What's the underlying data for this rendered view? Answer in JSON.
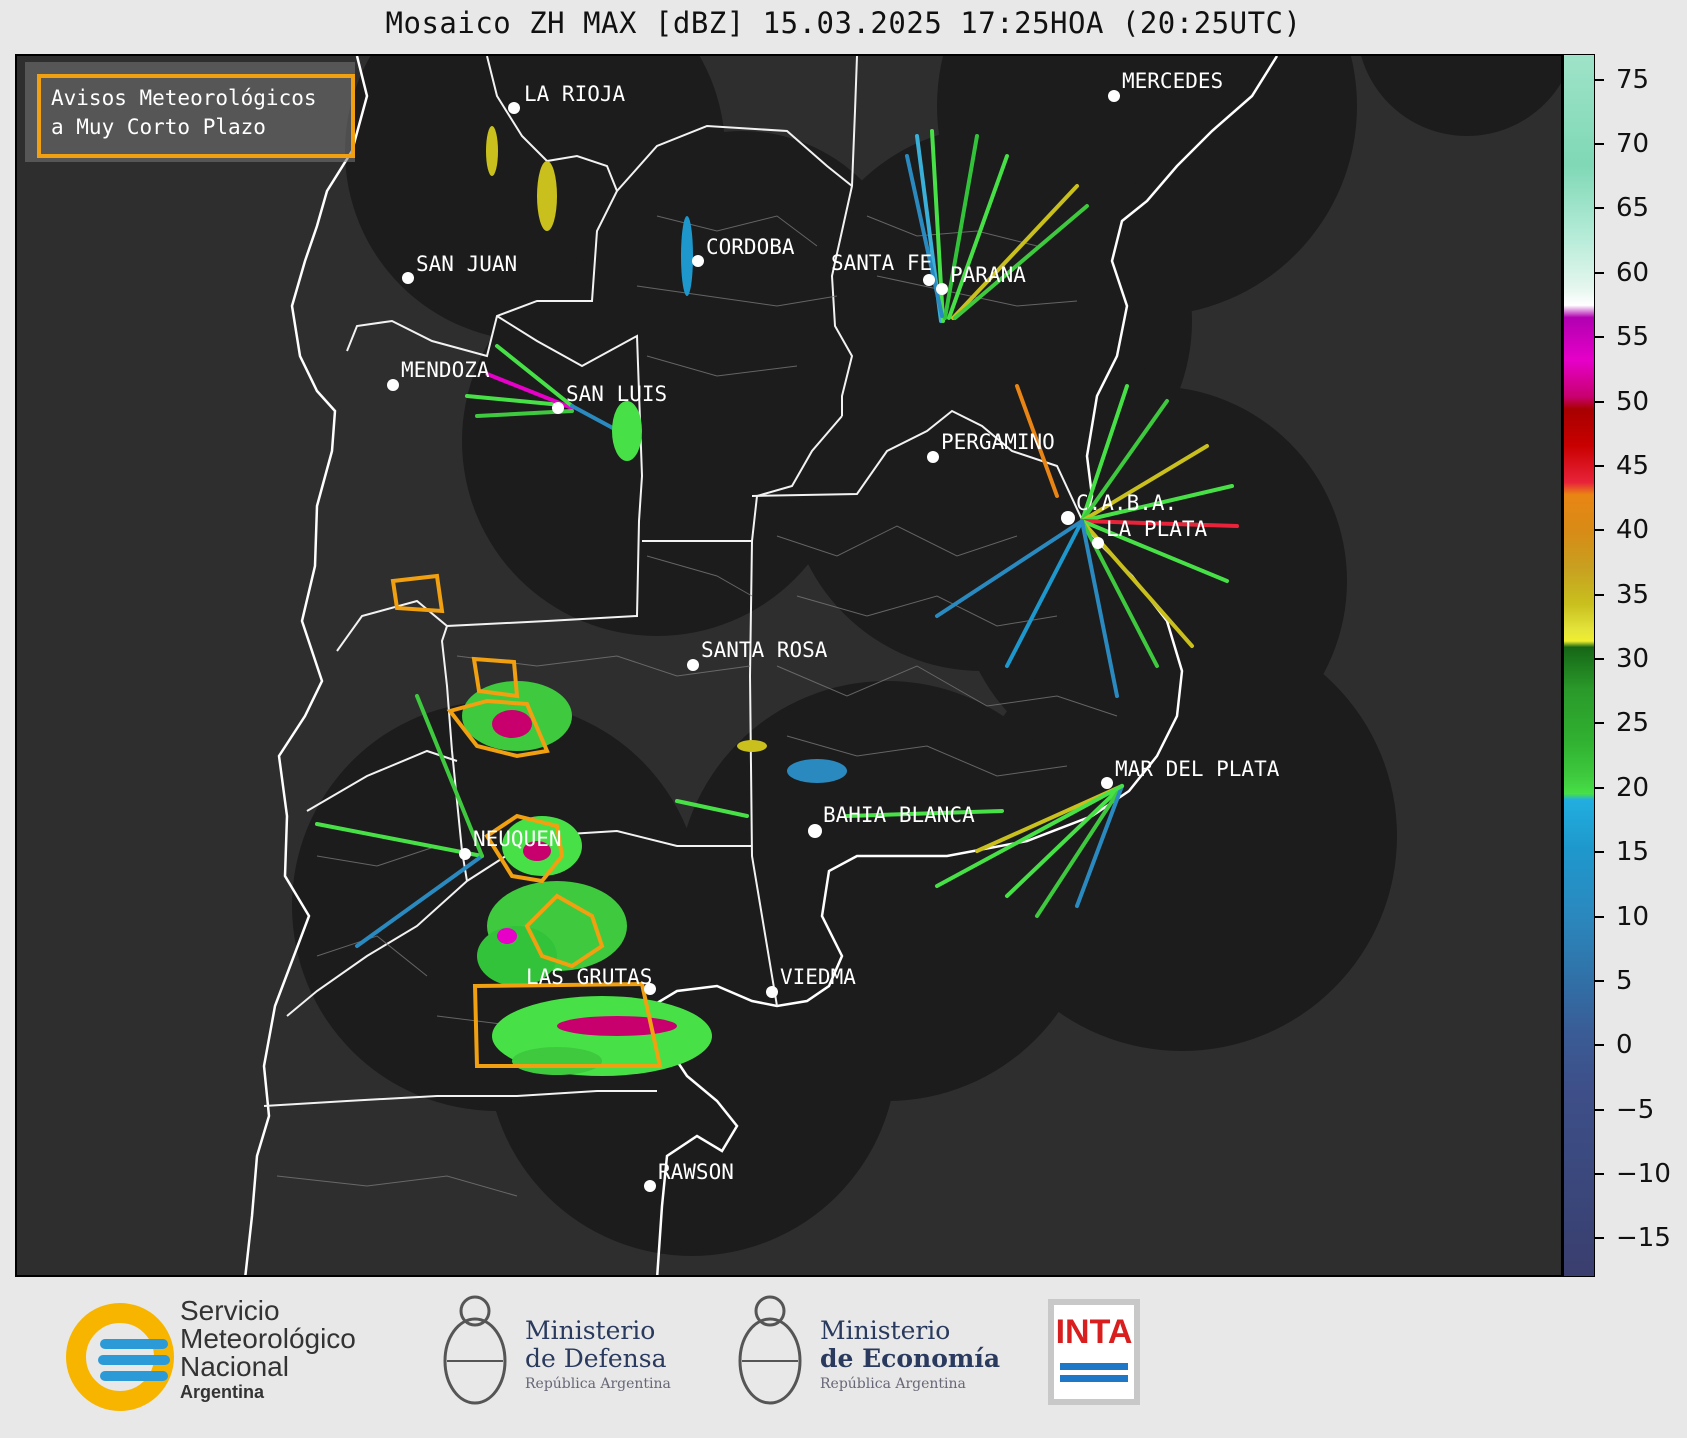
{
  "title": "Mosaico ZH MAX [dBZ] 15.03.2025 17:25HOA (20:25UTC)",
  "legend": {
    "line1": "Avisos Meteorológicos",
    "line2": "a Muy Corto Plazo",
    "border_color": "#f0a010"
  },
  "cities": [
    {
      "name": "LA RIOJA"
    },
    {
      "name": "MERCEDES"
    },
    {
      "name": "SAN JUAN"
    },
    {
      "name": "CORDOBA"
    },
    {
      "name": "SANTA FE"
    },
    {
      "name": "PARANA"
    },
    {
      "name": "MENDOZA"
    },
    {
      "name": "SAN LUIS"
    },
    {
      "name": "PERGAMINO"
    },
    {
      "name": "C.A.B.A."
    },
    {
      "name": "LA PLATA"
    },
    {
      "name": "SANTA ROSA"
    },
    {
      "name": "MAR DEL PLATA"
    },
    {
      "name": "BAHIA BLANCA"
    },
    {
      "name": "NEUQUEN"
    },
    {
      "name": "LAS GRUTAS"
    },
    {
      "name": "VIEDMA"
    },
    {
      "name": "RAWSON"
    }
  ],
  "colorbar": {
    "ticks": [
      "75",
      "70",
      "65",
      "60",
      "55",
      "50",
      "45",
      "40",
      "35",
      "30",
      "25",
      "20",
      "15",
      "10",
      "5",
      "0",
      "−5",
      "−10",
      "−15"
    ],
    "min": -18,
    "max": 77
  },
  "logos": {
    "smn": {
      "line1": "Servicio",
      "line2": "Meteorológico",
      "line3": "Nacional",
      "line4": "Argentina"
    },
    "defensa": {
      "line1": "Ministerio",
      "line2": "de Defensa",
      "line3": "República Argentina"
    },
    "economia": {
      "line1": "Ministerio",
      "line2": "de Economía",
      "line3": "República Argentina"
    },
    "inta": {
      "label": "INTA"
    }
  },
  "colors": {
    "radar_coverage": "#1c1c1c",
    "map_background": "#2e2e2e",
    "warning_polygon": "#f0a010",
    "border_lines": "#ffffff"
  }
}
